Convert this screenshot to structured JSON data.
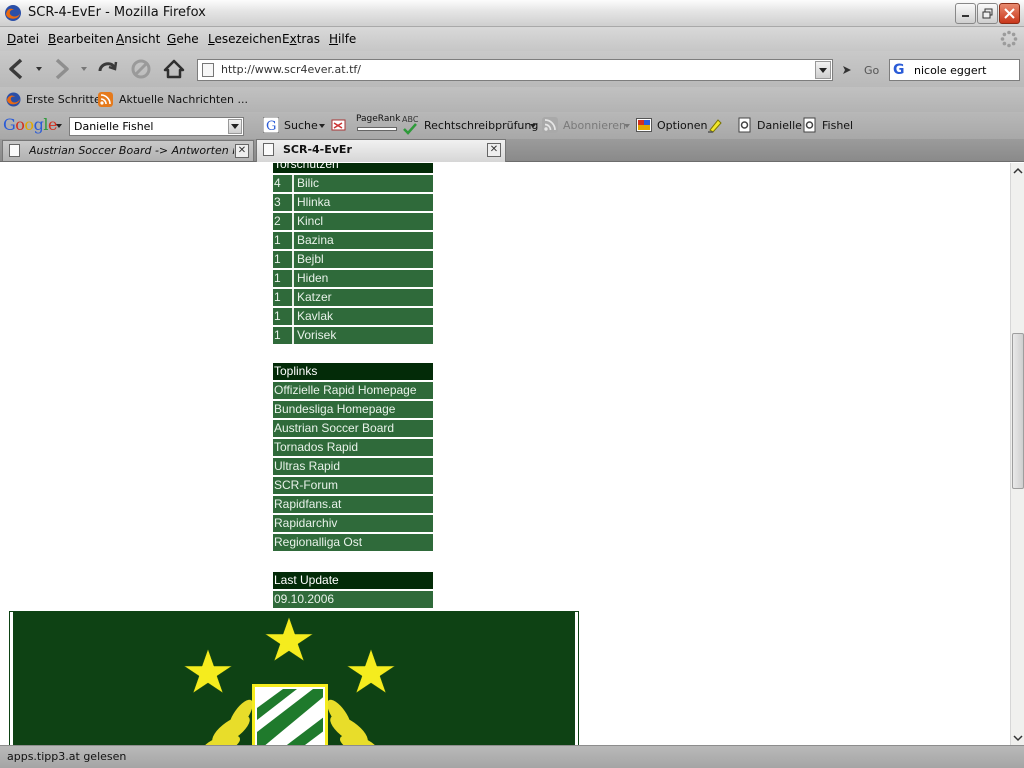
{
  "window": {
    "title": "SCR-4-EvEr - Mozilla Firefox"
  },
  "menu": {
    "items": [
      {
        "accel": "D",
        "rest": "atei"
      },
      {
        "accel": "B",
        "rest": "earbeiten"
      },
      {
        "accel": "A",
        "rest": "nsicht"
      },
      {
        "accel": "G",
        "rest": "ehe"
      },
      {
        "accel": "L",
        "rest": "esezeichen"
      },
      {
        "pre": "E",
        "accel": "x",
        "rest": "tras"
      },
      {
        "accel": "H",
        "rest": "ilfe"
      }
    ]
  },
  "nav": {
    "url": "http://www.scr4ever.at.tf/",
    "go_label": "Go",
    "search_value": "nicole eggert"
  },
  "bookmarks": {
    "items": [
      "Erste Schritte",
      "Aktuelle Nachrichten ..."
    ]
  },
  "google_toolbar": {
    "logo_letters": [
      "G",
      "o",
      "o",
      "g",
      "l",
      "e"
    ],
    "search_value": "Danielle Fishel",
    "suche": "Suche",
    "pagerank": "PageRank",
    "spell_abc": "ABC",
    "spellcheck": "Rechtschreibprüfung",
    "subscribe": "Abonnieren",
    "options": "Optionen",
    "term1": "Danielle",
    "term2": "Fishel"
  },
  "tabs": [
    {
      "label": "Austrian Soccer Board -> Antworten in ...",
      "active": false
    },
    {
      "label": "SCR-4-EvEr",
      "active": true
    }
  ],
  "page": {
    "scorers_header": "Torschützen",
    "scorers": [
      {
        "goals": "4",
        "name": "Bilic"
      },
      {
        "goals": "3",
        "name": "Hlinka"
      },
      {
        "goals": "2",
        "name": "Kincl"
      },
      {
        "goals": "1",
        "name": "Bazina"
      },
      {
        "goals": "1",
        "name": "Bejbl"
      },
      {
        "goals": "1",
        "name": "Hiden"
      },
      {
        "goals": "1",
        "name": "Katzer"
      },
      {
        "goals": "1",
        "name": "Kavlak"
      },
      {
        "goals": "1",
        "name": "Vorisek"
      }
    ],
    "toplinks_header": "Toplinks",
    "toplinks": [
      "Offizielle Rapid Homepage",
      "Bundesliga Homepage",
      "Austrian Soccer Board",
      "Tornados Rapid",
      "Ultras Rapid",
      "SCR-Forum",
      "Rapidfans.at",
      "Rapidarchiv",
      "Regionalliga Ost"
    ],
    "update_header": "Last Update",
    "update_value": "09.10.2006"
  },
  "status": {
    "text": "apps.tipp3.at gelesen"
  },
  "colors": {
    "row_green": "#2f6a3a",
    "header_dark": "#032b08",
    "crest_bg": "#0e4214",
    "star_yellow": "#f5ec1e"
  }
}
